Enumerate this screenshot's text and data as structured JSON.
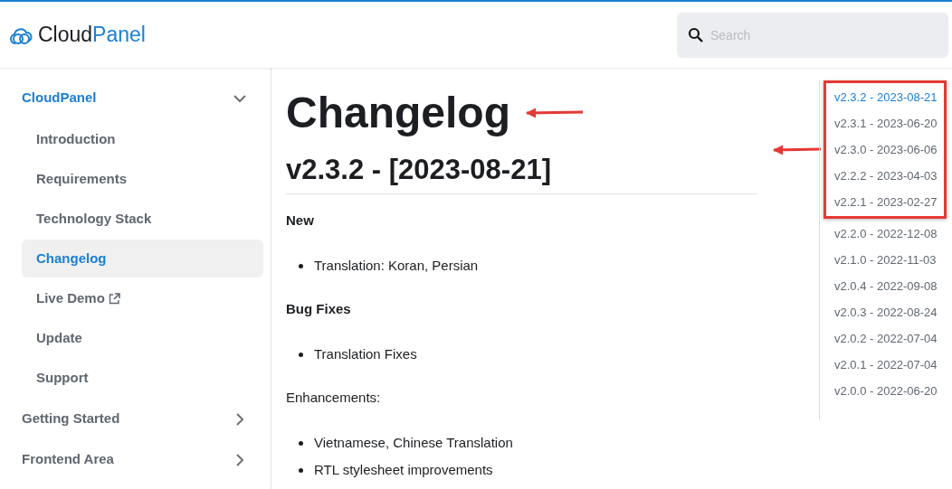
{
  "header": {
    "logo": {
      "part_1": "Cloud",
      "part_2": "Panel"
    },
    "search": {
      "placeholder": "Search"
    }
  },
  "sidebar": {
    "items": [
      {
        "label": "CloudPanel",
        "expanded": true,
        "children": [
          {
            "label": "Introduction",
            "selected": false,
            "external": false
          },
          {
            "label": "Requirements",
            "selected": false,
            "external": false
          },
          {
            "label": "Technology Stack",
            "selected": false,
            "external": false
          },
          {
            "label": "Changelog",
            "selected": true,
            "external": false
          },
          {
            "label": "Live Demo",
            "selected": false,
            "external": true
          },
          {
            "label": "Update",
            "selected": false,
            "external": false
          },
          {
            "label": "Support",
            "selected": false,
            "external": false
          }
        ]
      },
      {
        "label": "Getting Started",
        "expanded": false
      },
      {
        "label": "Frontend Area",
        "expanded": false
      }
    ]
  },
  "main": {
    "title": "Changelog",
    "section_title": "v2.3.2 - [2023-08-21]",
    "blocks": [
      {
        "kind": "heading",
        "text": "New"
      },
      {
        "kind": "list",
        "items": [
          "Translation: Koran, Persian"
        ]
      },
      {
        "kind": "heading",
        "text": "Bug Fixes"
      },
      {
        "kind": "list",
        "items": [
          "Translation Fixes"
        ]
      },
      {
        "kind": "label",
        "text": "Enhancements:"
      },
      {
        "kind": "list",
        "items": [
          "Vietnamese, Chinese Translation",
          "RTL stylesheet improvements"
        ]
      }
    ]
  },
  "toc": [
    {
      "label": "v2.3.2 - 2023-08-21",
      "selected": true,
      "highlighted": true
    },
    {
      "label": "v2.3.1 - 2023-06-20",
      "selected": false,
      "highlighted": true
    },
    {
      "label": "v2.3.0 - 2023-06-06",
      "selected": false,
      "highlighted": true
    },
    {
      "label": "v2.2.2 - 2023-04-03",
      "selected": false,
      "highlighted": true
    },
    {
      "label": "v2.2.1 - 2023-02-27",
      "selected": false,
      "highlighted": true
    },
    {
      "label": "v2.2.0 - 2022-12-08",
      "selected": false,
      "highlighted": false
    },
    {
      "label": "v2.1.0 - 2022-11-03",
      "selected": false,
      "highlighted": false
    },
    {
      "label": "v2.0.4 - 2022-09-08",
      "selected": false,
      "highlighted": false
    },
    {
      "label": "v2.0.3 - 2022-08-24",
      "selected": false,
      "highlighted": false
    },
    {
      "label": "v2.0.2 - 2022-07-04",
      "selected": false,
      "highlighted": false
    },
    {
      "label": "v2.0.1 - 2022-07-04",
      "selected": false,
      "highlighted": false
    },
    {
      "label": "v2.0.0 - 2022-06-20",
      "selected": false,
      "highlighted": false
    }
  ]
}
